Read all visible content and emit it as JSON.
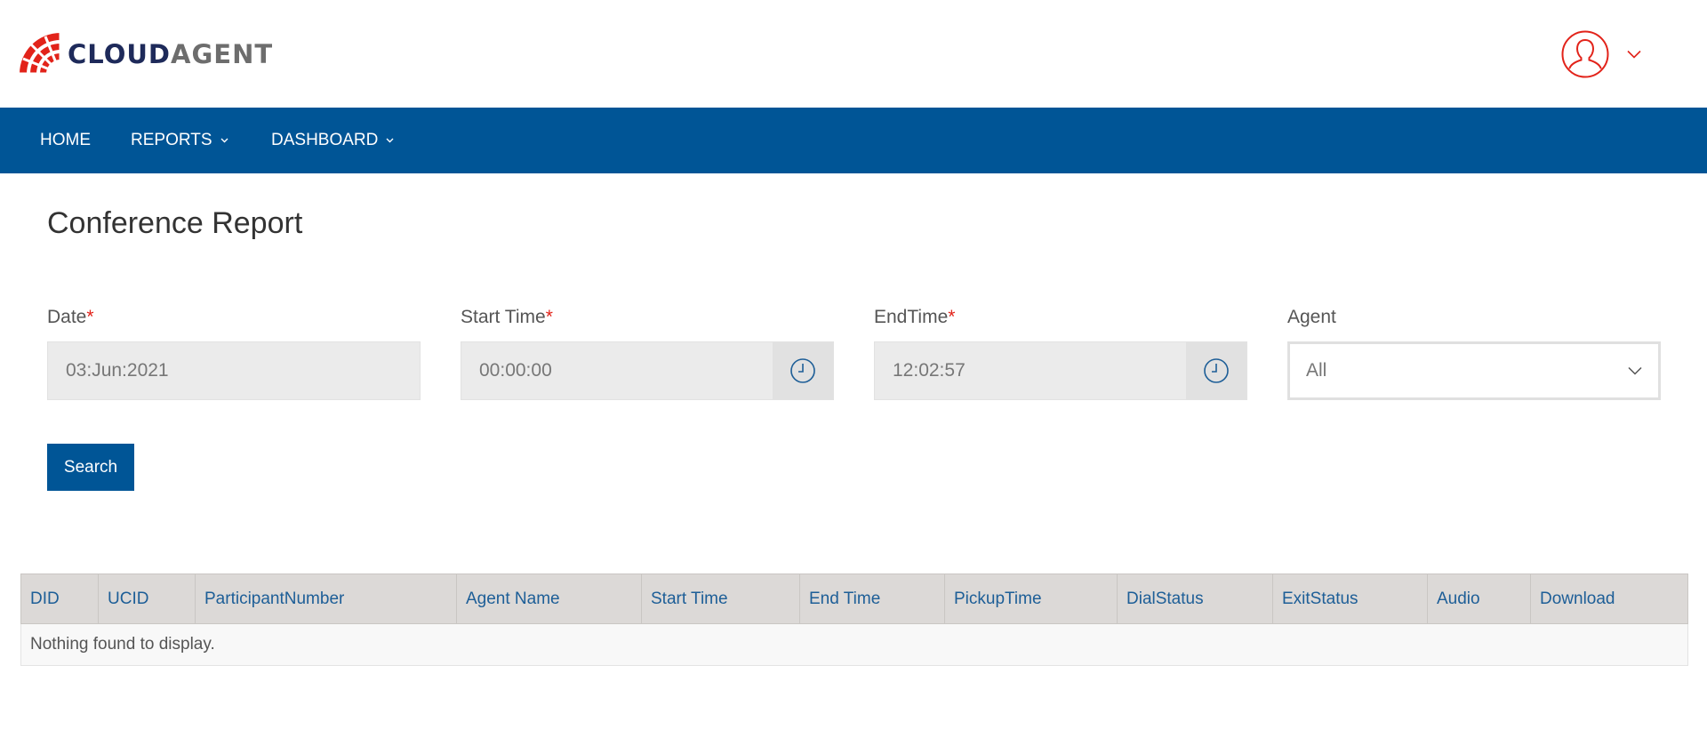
{
  "header": {
    "logo": {
      "word1": "CLOUD",
      "word2": "AGENT",
      "brand_red": "#e2231a",
      "brand_navy": "#1e2a5a"
    },
    "user_icon": "user-outline-icon"
  },
  "nav": {
    "items": [
      {
        "label": "HOME",
        "has_dropdown": false
      },
      {
        "label": "REPORTS",
        "has_dropdown": true
      },
      {
        "label": "DASHBOARD",
        "has_dropdown": true
      }
    ],
    "background": "#005596"
  },
  "page": {
    "title": "Conference Report"
  },
  "filters": {
    "date": {
      "label": "Date",
      "required_mark": "*",
      "value": "03:Jun:2021"
    },
    "start_time": {
      "label": "Start Time",
      "required_mark": "*",
      "value": "00:00:00"
    },
    "end_time": {
      "label": "EndTime",
      "required_mark": "*",
      "value": "12:02:57"
    },
    "agent": {
      "label": "Agent",
      "value": "All"
    }
  },
  "search_button": {
    "label": "Search"
  },
  "table": {
    "columns": [
      "DID",
      "UCID",
      "ParticipantNumber",
      "Agent Name",
      "Start Time",
      "End Time",
      "PickupTime",
      "DialStatus",
      "ExitStatus",
      "Audio",
      "Download"
    ],
    "empty_message": "Nothing found to display."
  }
}
